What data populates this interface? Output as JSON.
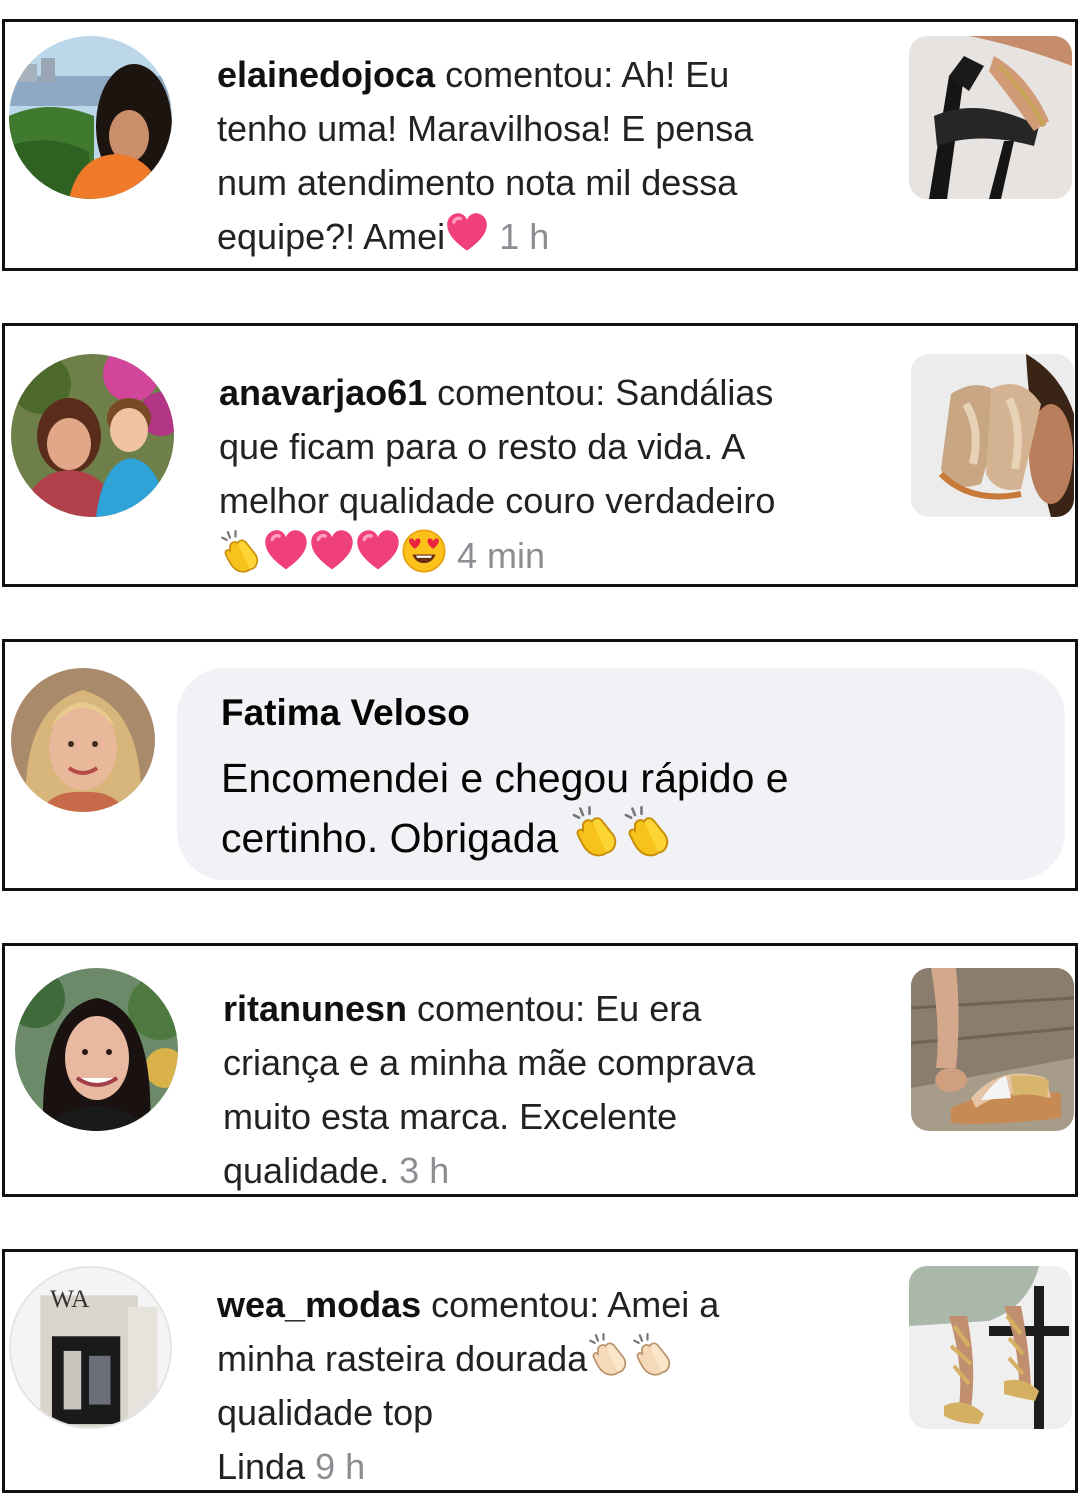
{
  "comments": [
    {
      "username": "elainedojoca",
      "verb": "comentou:",
      "lines": [
        "Ah! Eu",
        "tenho uma! Maravilhosa! E pensa",
        "num atendimento nota mil dessa",
        "equipe?! Amei"
      ],
      "emojis": [
        "heart-emoji"
      ],
      "time": "1 h"
    },
    {
      "username": "anavarjao61",
      "verb": "comentou:",
      "lines": [
        "Sandálias",
        "que ficam para o resto da vida. A",
        "melhor qualidade couro verdadeiro"
      ],
      "emojis": [
        "clap-emoji",
        "heart-emoji",
        "heart-emoji",
        "heart-emoji",
        "heart-eyes-emoji"
      ],
      "time": "4 min"
    },
    {
      "name": "Fatima Veloso",
      "lines": [
        "Encomendei e chegou rápido e",
        "certinho.  Obrigada"
      ],
      "emojis": [
        "clap-emoji",
        "clap-emoji"
      ]
    },
    {
      "username": "ritanunesn",
      "verb": "comentou:",
      "lines": [
        "Eu era",
        "criança e a minha mãe comprava",
        "muito esta marca. Excelente",
        "qualidade."
      ],
      "time": "3 h"
    },
    {
      "username": "wea_modas",
      "verb": "comentou:",
      "lines": [
        "Amei a",
        "minha rasteira dourada",
        "qualidade top",
        "Linda"
      ],
      "emojis": [
        "clap-emoji-light",
        "clap-emoji-light"
      ],
      "time": "9 h",
      "avatar_logo": "WA"
    }
  ],
  "colors": {
    "border": "#111111",
    "time": "#8a8d91",
    "bubble": "#f0f2f5",
    "heart": "#f0407a"
  }
}
